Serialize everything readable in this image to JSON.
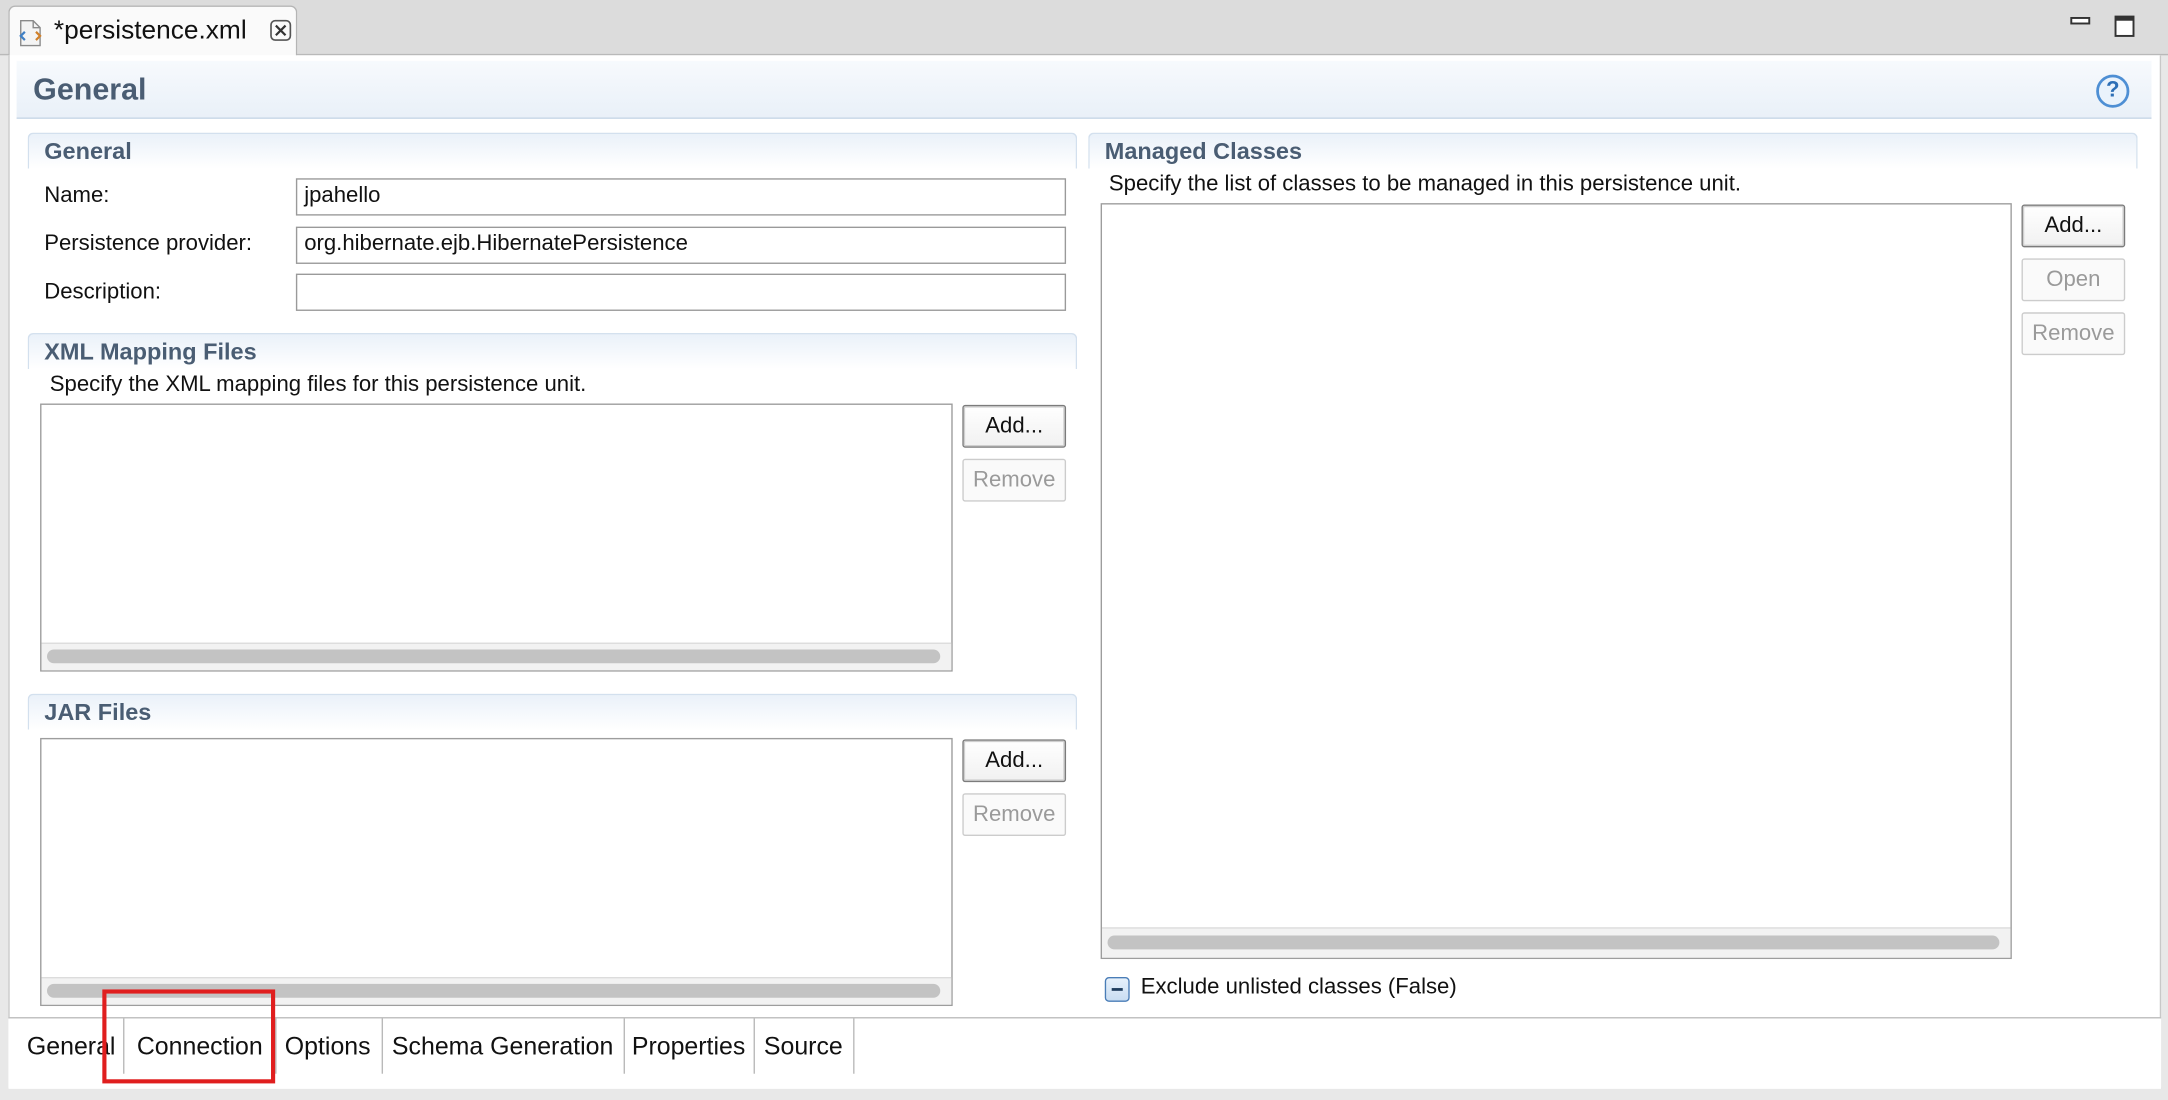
{
  "window": {
    "tab_title": "*persistence.xml",
    "icons": {
      "file": "xml-file-icon",
      "close": "close-icon",
      "minimize": "minimize-icon",
      "maximize": "maximize-icon"
    }
  },
  "page": {
    "title": "General",
    "help_icon": "help-icon",
    "help_glyph": "?"
  },
  "general": {
    "heading": "General",
    "name_label": "Name:",
    "name_value": "jpahello",
    "provider_label": "Persistence provider:",
    "provider_value": "org.hibernate.ejb.HibernatePersistence",
    "description_label": "Description:",
    "description_value": ""
  },
  "xml_mapping": {
    "heading": "XML Mapping Files",
    "description": "Specify the XML mapping files for this persistence unit.",
    "add_label": "Add...",
    "remove_label": "Remove"
  },
  "jar_files": {
    "heading": "JAR Files",
    "add_label": "Add...",
    "remove_label": "Remove"
  },
  "managed_classes": {
    "heading": "Managed Classes",
    "description": "Specify the list of classes to be managed in this persistence unit.",
    "add_label": "Add...",
    "open_label": "Open",
    "remove_label": "Remove",
    "exclude_label": "Exclude unlisted classes (False)",
    "exclude_icon": "tristate-checkbox-icon"
  },
  "page_tabs": [
    "General",
    "Connection",
    "Options",
    "Schema Generation",
    "Properties",
    "Source"
  ],
  "highlight": {
    "target": "Connection",
    "color": "#e01e1e"
  },
  "colors": {
    "section_title": "#4a5d73",
    "accent_blue": "#4e8fd4",
    "highlight_red": "#e01e1e"
  }
}
